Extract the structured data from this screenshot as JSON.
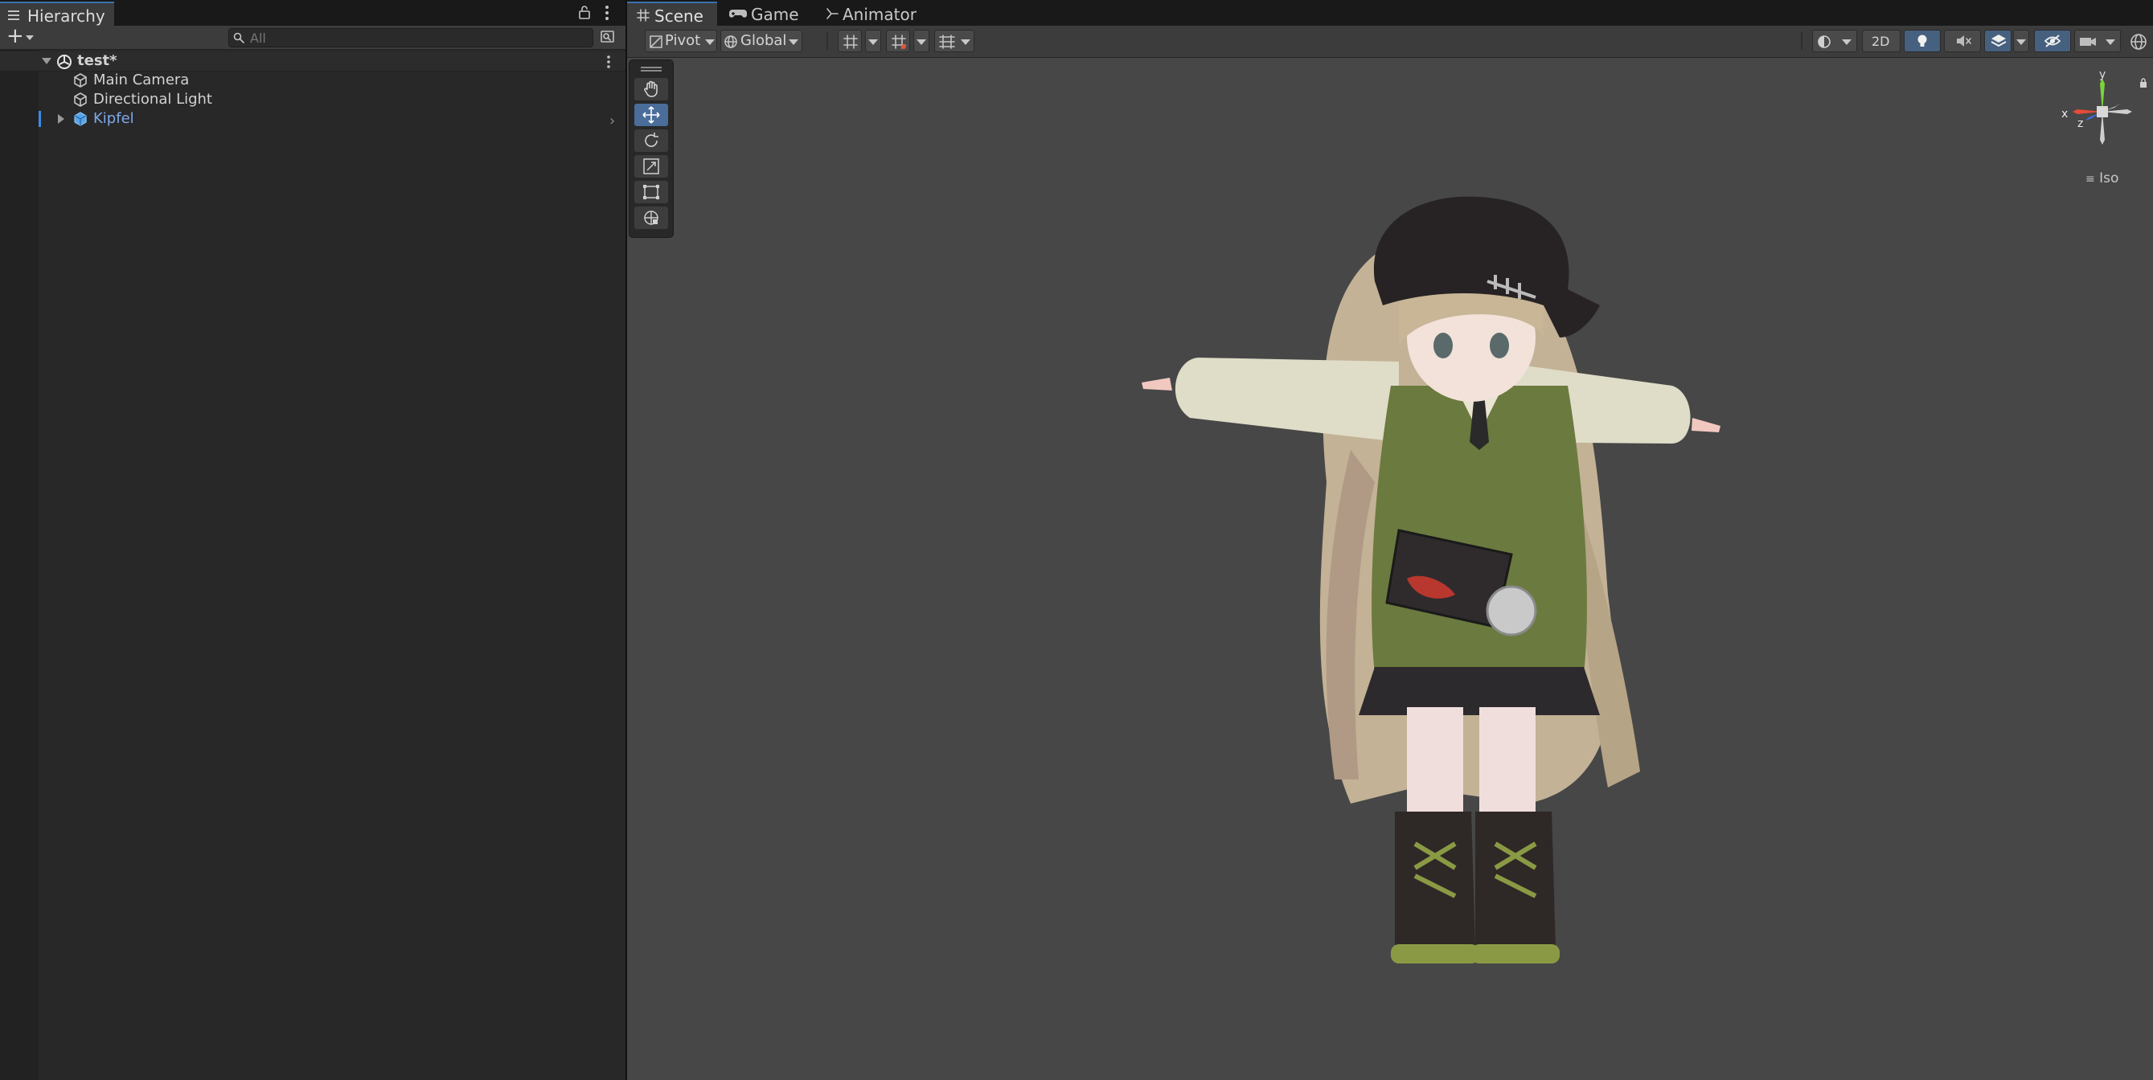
{
  "hierarchy": {
    "tab_label": "Hierarchy",
    "search_placeholder": "All",
    "add_label": "+",
    "scene": {
      "name": "test*"
    },
    "items": [
      {
        "name": "Main Camera"
      },
      {
        "name": "Directional Light"
      },
      {
        "name": "Kipfel"
      }
    ]
  },
  "scene_view": {
    "tabs": [
      {
        "label": "Scene"
      },
      {
        "label": "Game"
      },
      {
        "label": "Animator"
      }
    ],
    "toolbar": {
      "pivot_label": "Pivot",
      "space_label": "Global",
      "mode_2d_label": "2D"
    },
    "gizmo": {
      "x_label": "x",
      "y_label": "y",
      "z_label": "z",
      "projection_label": "Iso"
    },
    "tools": [
      {
        "name": "view-tool",
        "icon": "hand-icon",
        "active": false
      },
      {
        "name": "move-tool",
        "icon": "move-arrows-icon",
        "active": true
      },
      {
        "name": "rotate-tool",
        "icon": "rotate-icon",
        "active": false
      },
      {
        "name": "scale-tool",
        "icon": "scale-icon",
        "active": false
      },
      {
        "name": "rect-tool",
        "icon": "rect-icon",
        "active": false
      },
      {
        "name": "transform-tool",
        "icon": "transform-icon",
        "active": false
      }
    ]
  },
  "colors": {
    "accent_blue": "#3a8ee6",
    "selected_blue": "#7fa8e8",
    "scene_bg": "#474747",
    "panel_bg": "#282828"
  }
}
